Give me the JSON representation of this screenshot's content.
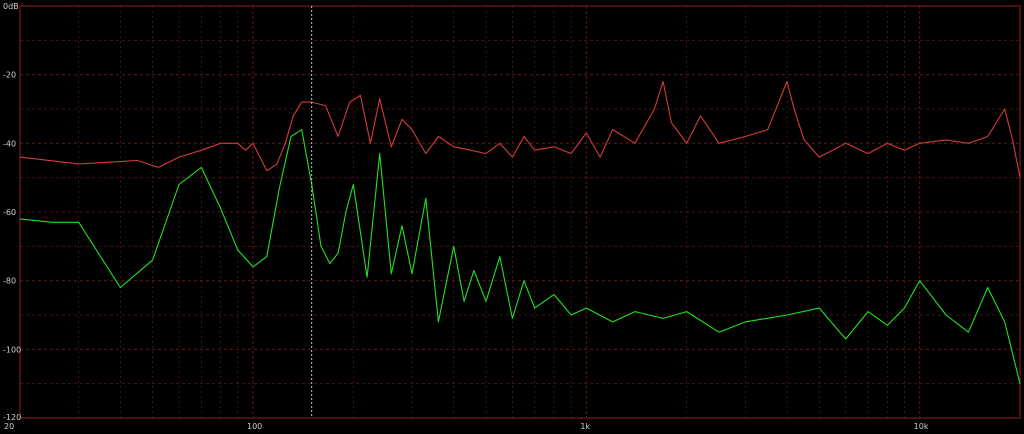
{
  "chart_data": {
    "type": "line",
    "title": "",
    "xlabel": "",
    "ylabel": "",
    "x_scale": "log",
    "xlim": [
      20,
      20000
    ],
    "ylim": [
      -120,
      0
    ],
    "grid": true,
    "x_ticks": [
      {
        "value": 20,
        "label": "20"
      },
      {
        "value": 100,
        "label": "100"
      },
      {
        "value": 1000,
        "label": "1k"
      },
      {
        "value": 10000,
        "label": "10k"
      }
    ],
    "y_ticks": [
      {
        "value": 0,
        "label": "0dB"
      },
      {
        "value": -20,
        "label": "-20"
      },
      {
        "value": -40,
        "label": "-40"
      },
      {
        "value": -60,
        "label": "-60"
      },
      {
        "value": -80,
        "label": "-80"
      },
      {
        "value": -100,
        "label": "-100"
      },
      {
        "value": -120,
        "label": "-120"
      }
    ],
    "cursor_x": 150,
    "colors": {
      "background": "#000000",
      "frame": "#7a1a1a",
      "grid": "#5a1414",
      "cursor": "#c8c8c8",
      "series_red": "#d43a3a",
      "series_green": "#22e022"
    },
    "series": [
      {
        "color": "#d43a3a",
        "x": [
          20,
          30,
          45,
          52,
          60,
          70,
          80,
          90,
          95,
          100,
          110,
          118,
          125,
          132,
          140,
          150,
          165,
          180,
          195,
          210,
          225,
          240,
          260,
          280,
          300,
          330,
          360,
          400,
          450,
          500,
          550,
          600,
          650,
          700,
          800,
          900,
          1000,
          1100,
          1200,
          1400,
          1600,
          1700,
          1800,
          1900,
          2000,
          2200,
          2500,
          3000,
          3500,
          4000,
          4200,
          4500,
          5000,
          6000,
          7000,
          8000,
          9000,
          10000,
          12000,
          14000,
          16000,
          18000,
          19000,
          20000
        ],
        "y": [
          -44,
          -46,
          -45,
          -47,
          -44,
          -42,
          -40,
          -40,
          -42,
          -40,
          -48,
          -46,
          -40,
          -32,
          -28,
          -28,
          -29,
          -38,
          -28,
          -26,
          -40,
          -27,
          -41,
          -33,
          -36,
          -43,
          -38,
          -41,
          -42,
          -43,
          -40,
          -44,
          -38,
          -42,
          -41,
          -43,
          -37,
          -44,
          -36,
          -40,
          -30,
          -22,
          -34,
          -37,
          -40,
          -32,
          -40,
          -38,
          -36,
          -22,
          -30,
          -39,
          -44,
          -40,
          -43,
          -40,
          -42,
          -40,
          -39,
          -40,
          -38,
          -30,
          -39,
          -50
        ]
      },
      {
        "color": "#22e022",
        "x": [
          20,
          25,
          30,
          40,
          50,
          60,
          70,
          80,
          90,
          100,
          110,
          120,
          130,
          140,
          150,
          160,
          170,
          180,
          190,
          200,
          220,
          240,
          260,
          280,
          300,
          330,
          360,
          400,
          430,
          460,
          500,
          550,
          600,
          650,
          700,
          800,
          900,
          1000,
          1200,
          1400,
          1700,
          2000,
          2500,
          3000,
          4000,
          5000,
          6000,
          7000,
          8000,
          9000,
          10000,
          12000,
          14000,
          16000,
          18000,
          20000
        ],
        "y": [
          -62,
          -63,
          -63,
          -82,
          -74,
          -52,
          -47,
          -59,
          -71,
          -76,
          -73,
          -53,
          -38,
          -36,
          -52,
          -70,
          -75,
          -72,
          -60,
          -52,
          -79,
          -43,
          -78,
          -64,
          -78,
          -56,
          -92,
          -70,
          -86,
          -77,
          -86,
          -73,
          -91,
          -80,
          -88,
          -84,
          -90,
          -88,
          -92,
          -89,
          -91,
          -89,
          -95,
          -92,
          -90,
          -88,
          -97,
          -89,
          -93,
          -88,
          -80,
          -90,
          -95,
          -82,
          -92,
          -110
        ]
      }
    ]
  }
}
